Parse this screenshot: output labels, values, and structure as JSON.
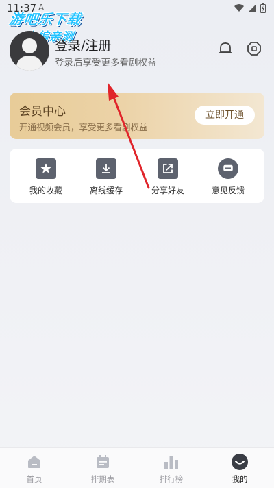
{
  "status_bar": {
    "time": "11:37",
    "indicator": "A"
  },
  "watermark": {
    "line1": "游吧乐下载",
    "line2": "小编亲测"
  },
  "profile": {
    "title": "登录/注册",
    "subtitle": "登录后享受更多看剧权益",
    "avatar_icon": "user-avatar-icon"
  },
  "header_icons": [
    "bell-icon",
    "settings-icon"
  ],
  "vip": {
    "title": "会员中心",
    "subtitle": "开通视频会员，享受更多看剧权益",
    "button_label": "立即开通"
  },
  "actions": [
    {
      "label": "我的收藏",
      "icon": "star-icon"
    },
    {
      "label": "离线缓存",
      "icon": "download-icon"
    },
    {
      "label": "分享好友",
      "icon": "share-icon"
    },
    {
      "label": "意见反馈",
      "icon": "feedback-icon"
    }
  ],
  "tabbar": [
    {
      "label": "首页",
      "icon": "home-icon",
      "active": false
    },
    {
      "label": "排期表",
      "icon": "calendar-icon",
      "active": false
    },
    {
      "label": "排行榜",
      "icon": "ranking-icon",
      "active": false
    },
    {
      "label": "我的",
      "icon": "profile-icon",
      "active": true
    }
  ],
  "colors": {
    "vip_gold": "#e8cc98",
    "active_tab": "#222222",
    "inactive_tab": "#9a9aa0",
    "annotation_arrow": "#e0252b"
  }
}
